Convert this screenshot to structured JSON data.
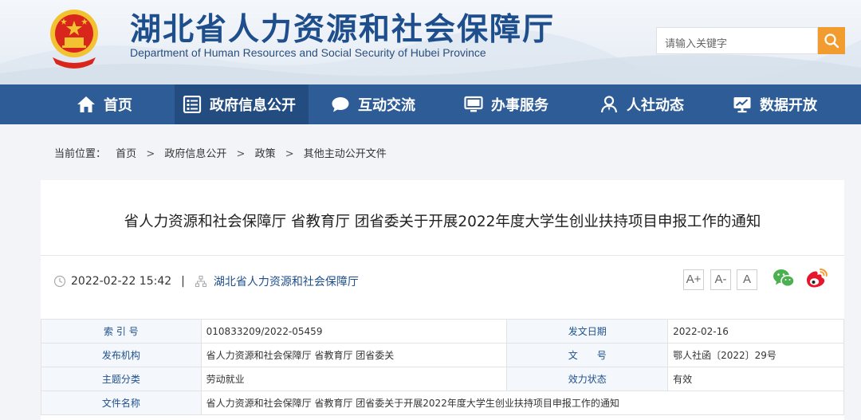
{
  "header": {
    "title": "湖北省人力资源和社会保障厅",
    "subtitle": "Department of Human Resources and Social Security of Hubei Province",
    "search_placeholder": "请输入关键字"
  },
  "nav": {
    "items": [
      {
        "label": "首页",
        "icon": "home-icon"
      },
      {
        "label": "政府信息公开",
        "icon": "document-list-icon"
      },
      {
        "label": "互动交流",
        "icon": "chat-bubble-icon"
      },
      {
        "label": "办事服务",
        "icon": "monitor-icon"
      },
      {
        "label": "人社动态",
        "icon": "person-news-icon"
      },
      {
        "label": "数据开放",
        "icon": "chart-trend-icon"
      }
    ],
    "active": "政府信息公开"
  },
  "breadcrumb": {
    "prefix": "当前位置：",
    "items": [
      "首页",
      "政府信息公开",
      "政策",
      "其他主动公开文件"
    ],
    "separator": ">"
  },
  "article": {
    "title": "省人力资源和社会保障厅 省教育厅 团省委关于开展2022年度大学生创业扶持项目申报工作的通知",
    "datetime": "2022-02-22 15:42",
    "divider": "|",
    "source": "湖北省人力资源和社会保障厅",
    "font_sizes": [
      "A+",
      "A-",
      "A"
    ]
  },
  "info_table": {
    "index_label": "索 引 号",
    "index_value": "010833209/2022-05459",
    "date_label": "发文日期",
    "date_value": "2022-02-16",
    "org_label": "发布机构",
    "org_value": "省人力资源和社会保障厅 省教育厅 团省委关",
    "doc_label": "文　　号",
    "doc_value": "鄂人社函〔2022〕29号",
    "category_label": "主题分类",
    "category_value": "劳动就业",
    "status_label": "效力状态",
    "status_value": "有效",
    "name_label": "文件名称",
    "name_value": "省人力资源和社会保障厅 省教育厅 团省委关于开展2022年度大学生创业扶持项目申报工作的通知"
  },
  "colors": {
    "nav_bg": "#2d5c96",
    "nav_active": "#234c80",
    "title_blue": "#1e4f8c",
    "search_button": "#f29b2e",
    "wechat": "#4cb050",
    "weibo": "#e6162d"
  }
}
